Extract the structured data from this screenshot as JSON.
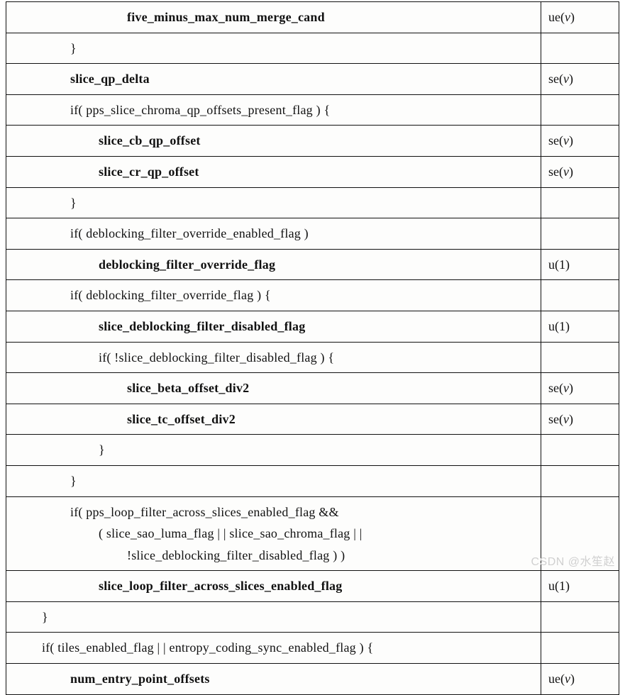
{
  "rows": [
    {
      "indent": 4,
      "bold": true,
      "text": "five_minus_max_num_merge_cand",
      "descriptor": "ue(v)"
    },
    {
      "indent": 2,
      "bold": false,
      "text": "}",
      "descriptor": ""
    },
    {
      "indent": 2,
      "bold": true,
      "text": "slice_qp_delta",
      "descriptor": "se(v)"
    },
    {
      "indent": 2,
      "bold": false,
      "text": "if( pps_slice_chroma_qp_offsets_present_flag ) {",
      "descriptor": ""
    },
    {
      "indent": 3,
      "bold": true,
      "text": "slice_cb_qp_offset",
      "descriptor": "se(v)"
    },
    {
      "indent": 3,
      "bold": true,
      "text": "slice_cr_qp_offset",
      "descriptor": "se(v)"
    },
    {
      "indent": 2,
      "bold": false,
      "text": "}",
      "descriptor": ""
    },
    {
      "indent": 2,
      "bold": false,
      "text": "if( deblocking_filter_override_enabled_flag )",
      "descriptor": ""
    },
    {
      "indent": 3,
      "bold": true,
      "text": "deblocking_filter_override_flag",
      "descriptor": "u(1)"
    },
    {
      "indent": 2,
      "bold": false,
      "text": "if( deblocking_filter_override_flag ) {",
      "descriptor": ""
    },
    {
      "indent": 3,
      "bold": true,
      "text": "slice_deblocking_filter_disabled_flag",
      "descriptor": "u(1)"
    },
    {
      "indent": 3,
      "bold": false,
      "text": "if( !slice_deblocking_filter_disabled_flag ) {",
      "descriptor": ""
    },
    {
      "indent": 4,
      "bold": true,
      "text": "slice_beta_offset_div2",
      "descriptor": "se(v)"
    },
    {
      "indent": 4,
      "bold": true,
      "text": "slice_tc_offset_div2",
      "descriptor": "se(v)"
    },
    {
      "indent": 3,
      "bold": false,
      "text": "}",
      "descriptor": ""
    },
    {
      "indent": 2,
      "bold": false,
      "text": "}",
      "descriptor": ""
    },
    {
      "indent": 2,
      "bold": false,
      "text": "if( pps_loop_filter_across_slices_enabled_flag   &&",
      "descriptor": "",
      "extra": [
        "( slice_sao_luma_flag   | |    slice_sao_chroma_flag   | |",
        "!slice_deblocking_filter_disabled_flag ) )"
      ],
      "extraIndent": [
        3,
        4
      ]
    },
    {
      "indent": 3,
      "bold": true,
      "text": "slice_loop_filter_across_slices_enabled_flag",
      "descriptor": "u(1)"
    },
    {
      "indent": 1,
      "bold": false,
      "text": "}",
      "descriptor": ""
    },
    {
      "indent": 1,
      "bold": false,
      "text": "if( tiles_enabled_flag   | |    entropy_coding_sync_enabled_flag ) {",
      "descriptor": ""
    },
    {
      "indent": 2,
      "bold": true,
      "text": "num_entry_point_offsets",
      "descriptor": "ue(v)"
    }
  ],
  "watermark": "CSDN @水笙赵"
}
